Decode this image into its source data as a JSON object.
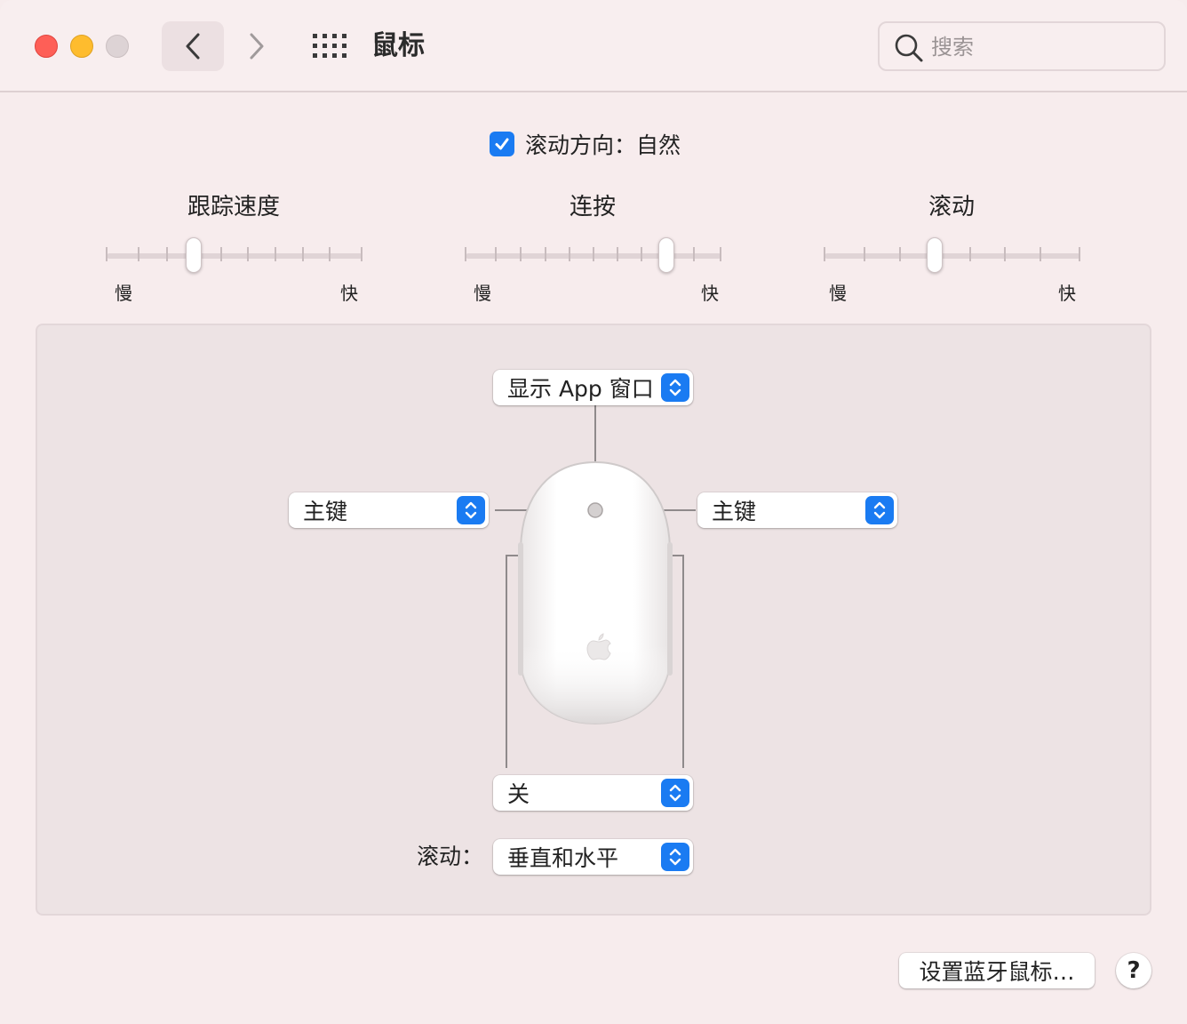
{
  "window": {
    "title": "鼠标"
  },
  "toolbar": {
    "back_icon": "chevron-left-icon",
    "forward_icon": "chevron-right-icon",
    "grid_icon": "show-all-grid-icon",
    "search_placeholder": "搜索",
    "search_value": ""
  },
  "scroll_direction": {
    "label": "滚动方向：自然",
    "checked": true
  },
  "sliders": [
    {
      "title": "跟踪速度",
      "min_label": "慢",
      "max_label": "快",
      "ticks": 10,
      "value_index": 3
    },
    {
      "title": "连按",
      "min_label": "慢",
      "max_label": "快",
      "ticks": 11,
      "value_index": 8
    },
    {
      "title": "滚动",
      "min_label": "慢",
      "max_label": "快",
      "ticks": 8,
      "value_index": 3
    }
  ],
  "mouse_config": {
    "top_popup": "显示 App 窗口",
    "left_popup": "主键",
    "right_popup": "主键",
    "bottom_popup": "关",
    "scroll_label": "滚动：",
    "scroll_popup": "垂直和水平"
  },
  "footer": {
    "bluetooth_button": "设置蓝牙鼠标…",
    "help_button": "?"
  },
  "colors": {
    "accent": "#1a7bf2",
    "background": "#f7eced",
    "panel": "#ede3e4",
    "close": "#fe5f57",
    "minimize": "#febc2e"
  }
}
